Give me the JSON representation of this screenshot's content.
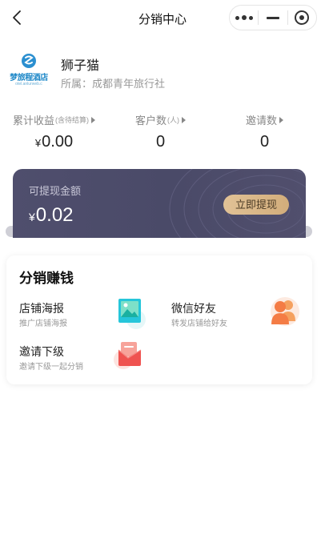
{
  "nav": {
    "title": "分销中心"
  },
  "profile": {
    "logo_text": "梦旅程酒店",
    "logo_sub": "otel.anlurweb.c",
    "name": "狮子猫",
    "org": "所属：成都青年旅行社"
  },
  "stats": [
    {
      "label": "累计收益",
      "note": "(含待结算)",
      "prefix": "¥",
      "value": "0.00"
    },
    {
      "label": "客户数",
      "note": "(人)",
      "prefix": "",
      "value": "0"
    },
    {
      "label": "邀请数",
      "note": "",
      "prefix": "",
      "value": "0"
    }
  ],
  "withdraw": {
    "label": "可提现金额",
    "currency": "¥",
    "amount": "0.02",
    "button": "立即提现"
  },
  "earn": {
    "title": "分销赚钱",
    "items": [
      {
        "title": "店铺海报",
        "desc": "推广店铺海报",
        "icon": "poster-icon"
      },
      {
        "title": "微信好友",
        "desc": "转发店铺给好友",
        "icon": "friends-icon"
      },
      {
        "title": "邀请下级",
        "desc": "邀请下级一起分销",
        "icon": "invite-icon"
      }
    ]
  },
  "colors": {
    "card_bg": "#4a4a68",
    "button_gold": "#d9b886",
    "accent_orange": "#f47c45",
    "accent_red": "#ef5350",
    "accent_teal": "#26c6da"
  }
}
